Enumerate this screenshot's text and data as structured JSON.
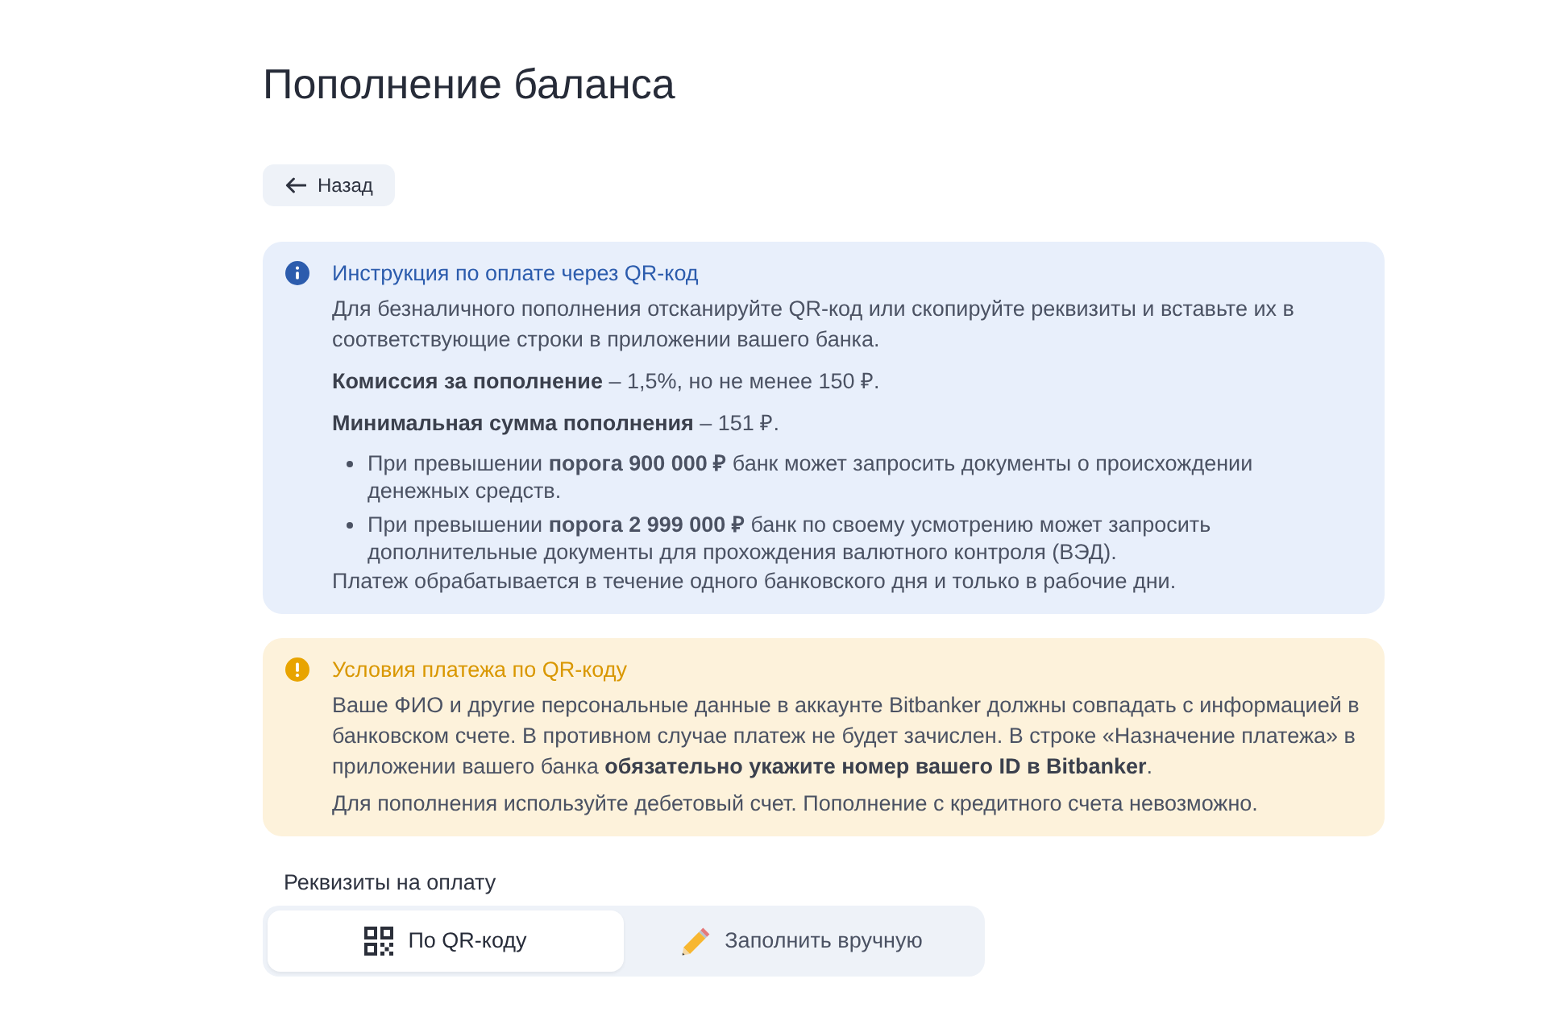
{
  "page": {
    "title": "Пополнение баланса"
  },
  "back_button": {
    "label": "Назад"
  },
  "notices": [
    {
      "kind": "info",
      "title": "Инструкция по оплате через QR-код",
      "blocks": [
        {
          "kind": "paragraph",
          "text": "Для безналичного пополнения отсканируйте QR-код или скопируйте реквизиты и вставьте их в соответствующие строки в приложении вашего банка."
        },
        {
          "kind": "paragraph",
          "text": "**Комиссия за пополнение** – 1,5%, но не менее 150 ₽."
        },
        {
          "kind": "paragraph",
          "text": "**Минимальная сумма пополнения** – 151 ₽."
        },
        {
          "kind": "bullets",
          "items": [
            "При превышении **порога 900 000 ₽** банк может запросить документы о происхождении денежных средств.",
            "При превышении **порога 2 999 000 ₽** банк по своему усмотрению может запросить дополнительные документы для прохождения валютного контроля (ВЭД)."
          ]
        },
        {
          "kind": "paragraph",
          "text": "Платеж обрабатывается в течение одного банковского дня и только в рабочие дни."
        }
      ]
    },
    {
      "kind": "warning",
      "title": "Условия платежа по QR-коду",
      "blocks": [
        {
          "kind": "paragraph",
          "text": "Ваше ФИО и другие персональные данные в аккаунте Bitbanker должны совпадать с информацией в банковском счете. В противном случае платеж не будет зачислен. В строке «Назначение платежа» в приложении вашего банка **обязательно укажите номер вашего ID в Bitbanker**."
        },
        {
          "kind": "paragraph",
          "text": "Для пополнения используйте дебетовый счет. Пополнение с кредитного счета невозможно."
        }
      ]
    }
  ],
  "payment_details": {
    "label": "Реквизиты на оплату",
    "tabs": [
      {
        "kind": "qr",
        "label": "По QR-коду",
        "selected": true
      },
      {
        "kind": "pencil",
        "label": "Заполнить вручную",
        "selected": false
      }
    ]
  }
}
